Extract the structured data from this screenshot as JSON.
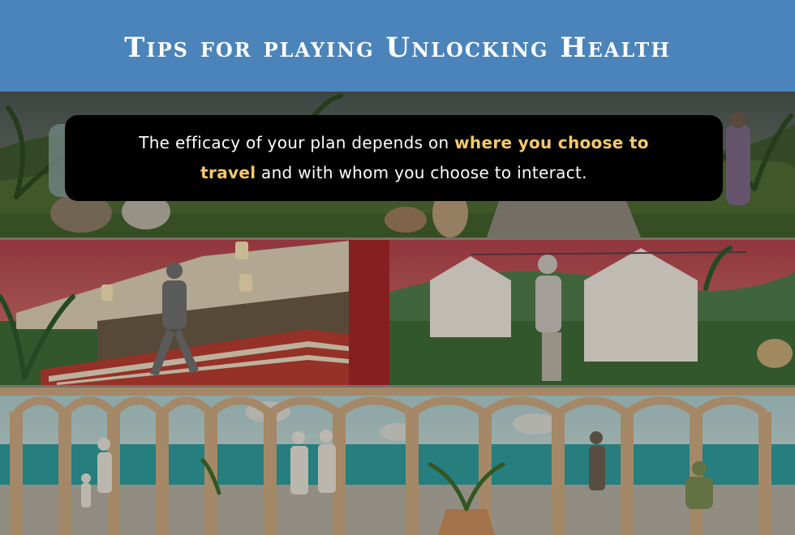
{
  "header": {
    "title": "Tips for playing Unlocking Health"
  },
  "tip": {
    "text_before": "The efficacy of your plan depends on ",
    "highlight": "where you choose to travel",
    "text_after": " and with whom you choose to interact."
  },
  "colors": {
    "header_bg": "#4a84bb",
    "highlight": "#f7c96b",
    "tip_box_bg": "#000000"
  },
  "scenes": [
    {
      "name": "jungle-village"
    },
    {
      "name": "tent-market"
    },
    {
      "name": "seaside-colonnade"
    }
  ]
}
